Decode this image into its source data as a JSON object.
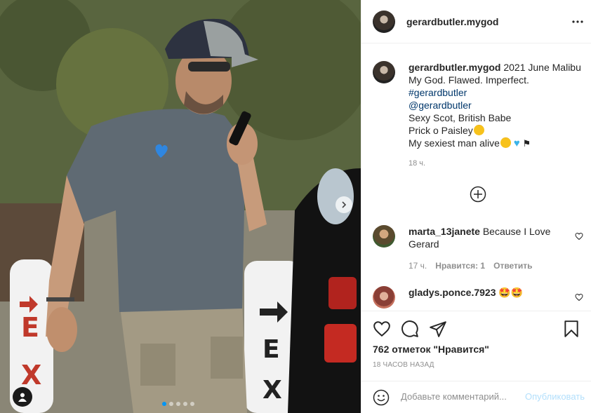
{
  "post": {
    "author": "gerardbutler.mygod",
    "photo_alt": "Man in cap talking on phone",
    "carousel": {
      "slides": 5,
      "active_index": 0
    }
  },
  "caption": {
    "author": "gerardbutler.mygod",
    "first_line": "2021 June Malibu",
    "line2": "My God. Flawed. Imperfect.",
    "hashtag": "#gerardbutler",
    "mention": "@gerardbutler",
    "line5": "Sexy Scot, British Babe",
    "line6": "Prick o Paisley",
    "line7": "My sexiest man alive",
    "time": "18 ч."
  },
  "comments": [
    {
      "author": "marta_13janete",
      "text": "Because I Love Gerard",
      "time": "17 ч.",
      "likes_label": "Нравится: 1",
      "reply_label": "Ответить",
      "avatar_color": "#6b5a3c"
    },
    {
      "author": "gladys.ponce.7923",
      "text": "🤩🤩",
      "avatar_color": "#b9695a"
    }
  ],
  "actions": {
    "likes_text": "762 отметок \"Нравится\"",
    "posted_text": "18 часов назад"
  },
  "add_comment": {
    "placeholder": "Добавьте комментарий...",
    "publish_label": "Опубликовать"
  },
  "colors": {
    "link": "#00376b",
    "publish_disabled": "#b2dffc",
    "muted": "#8e8e8e",
    "carousel_active": "#0095f6"
  }
}
